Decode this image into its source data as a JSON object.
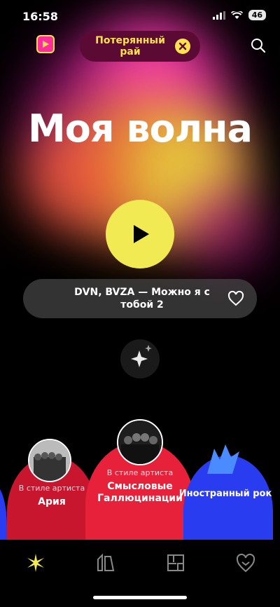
{
  "status_bar": {
    "time": "16:58",
    "battery": "46"
  },
  "header": {
    "pill_text": "Потерянный рай"
  },
  "main": {
    "title": "Моя волна",
    "track": "DVN, BVZA — Можно я с тобой 2"
  },
  "cards": [
    {
      "subtitle": "В стиле артиста",
      "label": "Ария"
    },
    {
      "subtitle": "В стиле артиста",
      "label": "Смысловые Галлюцинации"
    },
    {
      "subtitle": "",
      "label": "Иностранный рок"
    }
  ],
  "colors": {
    "accent_yellow": "#F2EA52",
    "pill_bg": "#5B0A33",
    "card_red": "#E8213A",
    "card_blue": "#2A3CF0"
  }
}
